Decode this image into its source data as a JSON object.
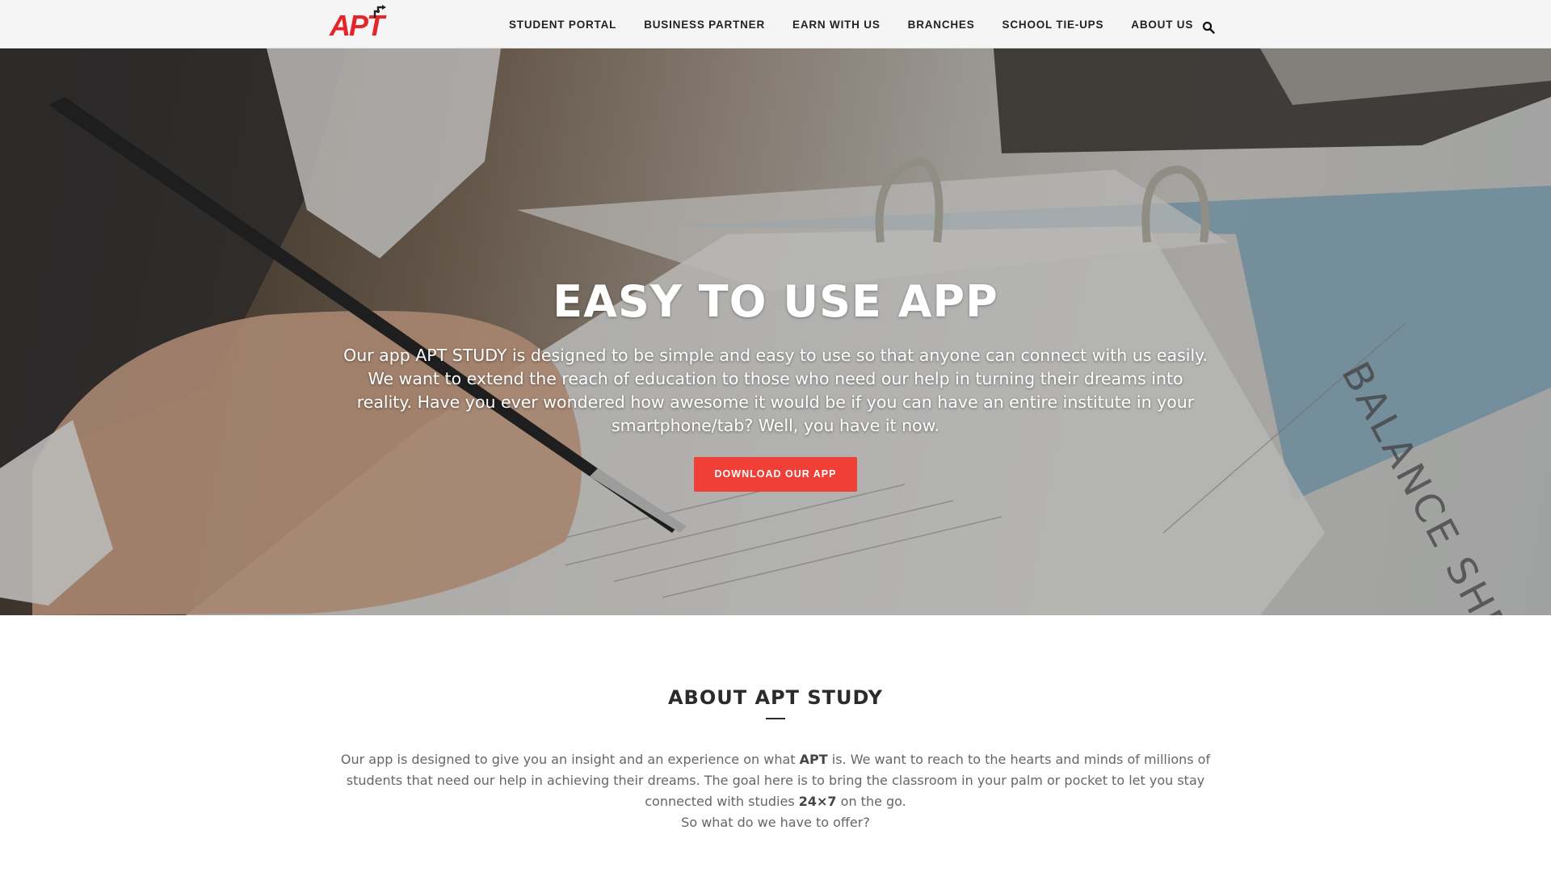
{
  "brand": {
    "logo_text": "APT",
    "accent": "#e4262b"
  },
  "nav": {
    "items": [
      {
        "label": "STUDENT PORTAL"
      },
      {
        "label": "BUSINESS PARTNER"
      },
      {
        "label": "EARN WITH US"
      },
      {
        "label": "BRANCHES"
      },
      {
        "label": "SCHOOL TIE-UPS"
      },
      {
        "label": "ABOUT US"
      }
    ],
    "search_icon": "search-icon"
  },
  "hero": {
    "title": "EASY TO USE APP",
    "text": "Our app APT STUDY is designed to be simple and easy to use so that anyone can connect with us easily. We want to extend the reach of education to those who need our help in turning their dreams into reality. Have you ever wondered how awesome it would be if you can have an entire institute in your smartphone/tab? Well, you have it now.",
    "button_label": "DOWNLOAD OUR APP",
    "button_color": "#ef3f36",
    "background_photo_text": "BALANCE SHEE"
  },
  "about": {
    "title": "ABOUT APT STUDY",
    "p1_part1": "Our app is designed to give you an insight and an experience on what ",
    "p1_bold1": "APT",
    "p1_part2": " is. We want to reach to the hearts and minds of millions of students that need our help in achieving their dreams. The goal here is to bring the classroom in your palm or pocket to let you stay connected with studies ",
    "p1_bold2": "24×7",
    "p1_part3": " on the go.",
    "p2": "So what do we have to offer?"
  }
}
